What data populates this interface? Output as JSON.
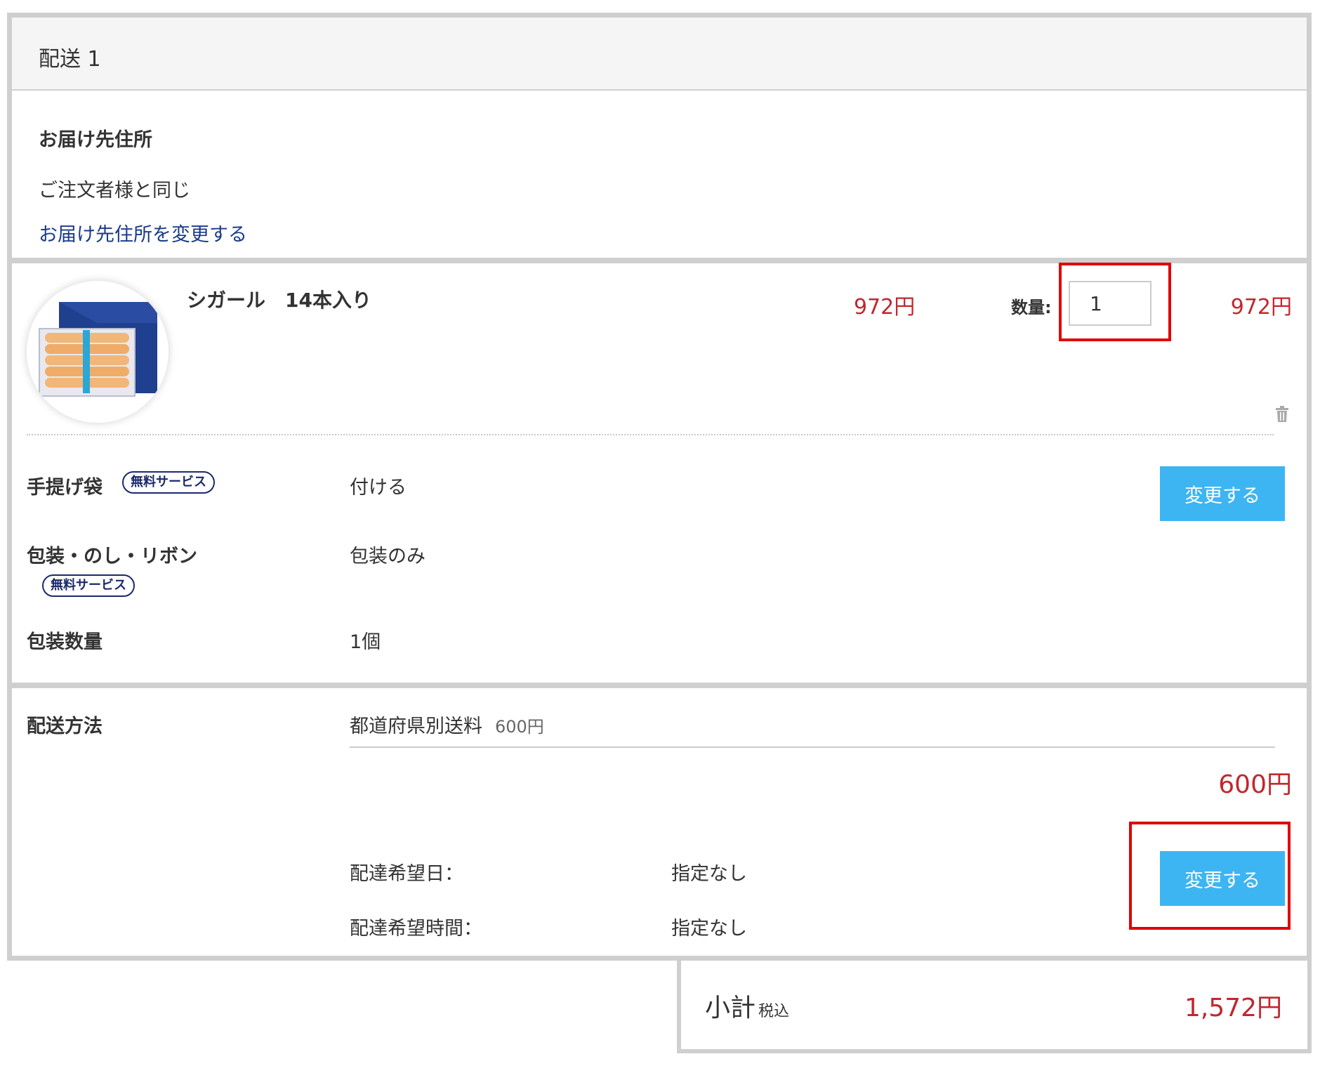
{
  "shipping": {
    "header": "配送 1",
    "address": {
      "title": "お届け先住所",
      "value": "ご注文者様と同じ",
      "change_link": "お届け先住所を変更する"
    }
  },
  "product": {
    "name": "シガール　14本入り",
    "unit_price": "972円",
    "quantity_label": "数量:",
    "quantity": "1",
    "line_price": "972円",
    "image_icon": "cigar-cookie-box-image",
    "delete_icon": "trash-icon"
  },
  "options": {
    "bag": {
      "label": "手提げ袋",
      "badge": "無料サービス",
      "value": "付ける"
    },
    "wrapping": {
      "label": "包装・のし・リボン",
      "badge": "無料サービス",
      "value": "包装のみ"
    },
    "wrap_qty": {
      "label": "包装数量",
      "value": "1個"
    },
    "change_button": "変更する"
  },
  "delivery": {
    "label": "配送方法",
    "method": "都道府県別送料",
    "method_price": "600円",
    "total": "600円",
    "date_label": "配達希望日：",
    "date_value": "指定なし",
    "time_label": "配達希望時間：",
    "time_value": "指定なし",
    "change_button": "変更する"
  },
  "subtotal": {
    "label": "小計",
    "tax_note": "税込",
    "value": "1,572円"
  },
  "colors": {
    "price_red": "#c0282d",
    "button_blue": "#3db5f2",
    "link_blue": "#1a3a8a",
    "highlight_red": "#e00000"
  }
}
